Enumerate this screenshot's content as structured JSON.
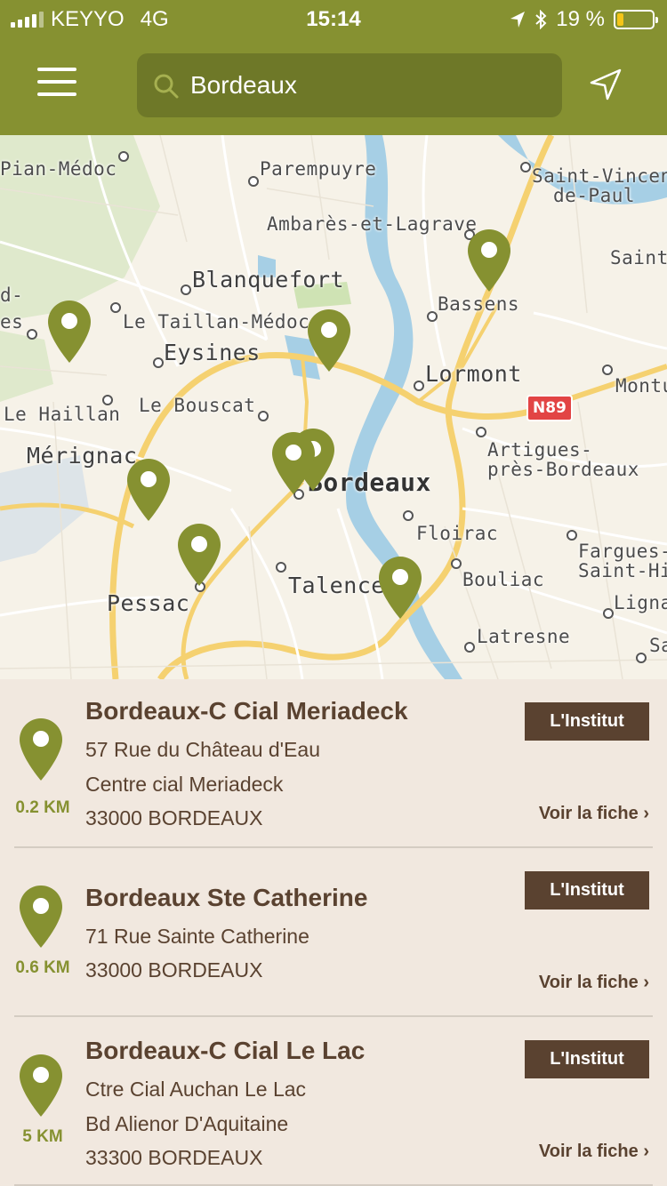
{
  "status_bar": {
    "carrier": "KEYYO",
    "network": "4G",
    "time": "15:14",
    "battery_text": "19 %",
    "battery_level": 0.19
  },
  "header": {
    "search_value": "Bordeaux",
    "menu_icon": "hamburger-menu-icon",
    "locate_icon": "navigation-arrow-icon"
  },
  "map": {
    "labels": [
      {
        "text": "Pian-Médoc",
        "style": ""
      },
      {
        "text": "Parempuyre",
        "style": ""
      },
      {
        "text": "Saint-Vincent-",
        "style": ""
      },
      {
        "text": "de-Paul",
        "style": ""
      },
      {
        "text": "Ambarès-et-Lagrave",
        "style": ""
      },
      {
        "text": "Saint-",
        "style": ""
      },
      {
        "text": "Blanquefort",
        "style": "big"
      },
      {
        "text": "d-",
        "style": ""
      },
      {
        "text": "es",
        "style": ""
      },
      {
        "text": "Le Taillan-Médoc",
        "style": ""
      },
      {
        "text": "Bassens",
        "style": ""
      },
      {
        "text": "Eysines",
        "style": "big"
      },
      {
        "text": "Lormont",
        "style": "big"
      },
      {
        "text": "Montu",
        "style": ""
      },
      {
        "text": "Le Haillan",
        "style": ""
      },
      {
        "text": "Le Bouscat",
        "style": ""
      },
      {
        "text": "Artigues-",
        "style": ""
      },
      {
        "text": "près-Bordeaux",
        "style": ""
      },
      {
        "text": "Mérignac",
        "style": "big"
      },
      {
        "text": "Bordeaux",
        "style": "city"
      },
      {
        "text": "Floirac",
        "style": ""
      },
      {
        "text": "Fargues-",
        "style": ""
      },
      {
        "text": "Saint-Hila",
        "style": ""
      },
      {
        "text": "Bouliac",
        "style": ""
      },
      {
        "text": "Talence",
        "style": "big"
      },
      {
        "text": "Ligna",
        "style": ""
      },
      {
        "text": "Pessac",
        "style": "big"
      },
      {
        "text": "Latresne",
        "style": ""
      },
      {
        "text": "Sa",
        "style": ""
      }
    ],
    "road_badge": "N89",
    "pin_color": "#869131"
  },
  "results": [
    {
      "title": "Bordeaux-C Cial Meriadeck",
      "lines": [
        "57 Rue du Château d'Eau",
        "Centre cial Meriadeck",
        "33000 BORDEAUX"
      ],
      "distance": "0.2 KM",
      "tag": "L'Institut",
      "link": "Voir la fiche"
    },
    {
      "title": "Bordeaux Ste Catherine",
      "lines": [
        "71 Rue Sainte Catherine",
        "33000 BORDEAUX"
      ],
      "distance": "0.6 KM",
      "tag": "L'Institut",
      "link": "Voir la fiche"
    },
    {
      "title": "Bordeaux-C Cial Le Lac",
      "lines": [
        "Ctre Cial Auchan Le Lac",
        "Bd Alienor D'Aquitaine",
        "33300 BORDEAUX"
      ],
      "distance": "5 KM",
      "tag": "L'Institut",
      "link": "Voir la fiche"
    }
  ],
  "colors": {
    "brand_green": "#869131",
    "search_field": "#6e7828",
    "text_brown": "#5a4230",
    "list_bg": "#f1e8df"
  }
}
